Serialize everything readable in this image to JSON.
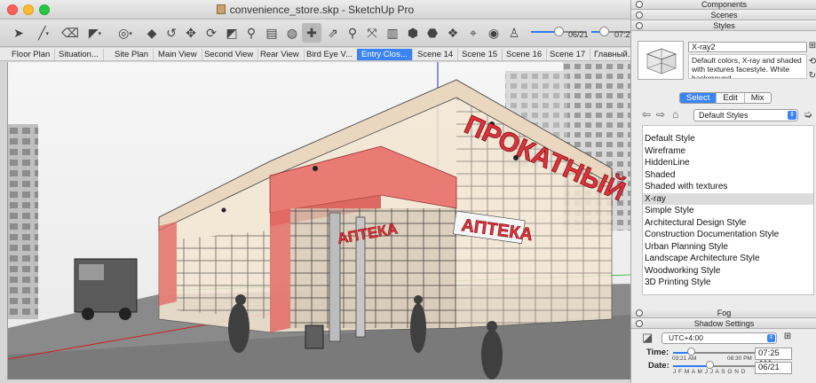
{
  "window": {
    "title": "convenience_store.skp - SketchUp Pro"
  },
  "toolbar": {
    "time_date": "06/21",
    "time_value": "07:2"
  },
  "scene_tabs": [
    {
      "label": "Floor Plan",
      "active": false
    },
    {
      "label": "Situation...",
      "active": false
    },
    {
      "label": "Site Plan",
      "active": false
    },
    {
      "label": "Main View",
      "active": false
    },
    {
      "label": "Second View",
      "active": false
    },
    {
      "label": "Rear View",
      "active": false
    },
    {
      "label": "Bird Eye V...",
      "active": false
    },
    {
      "label": "Entry Clos...",
      "active": true
    },
    {
      "label": "Scene 14",
      "active": false
    },
    {
      "label": "Scene 15",
      "active": false
    },
    {
      "label": "Scene 16",
      "active": false
    },
    {
      "label": "Scene 17",
      "active": false
    },
    {
      "label": "Главный...",
      "active": false
    }
  ],
  "viewport": {
    "sign_main": "ПРОКАТНЫЙ",
    "sign_pharmacy": "АПТЕКА",
    "sign_pharmacy_left": "АПТЕКА"
  },
  "tray": {
    "panels": {
      "components": "Components",
      "scenes": "Scenes",
      "styles": "Styles",
      "fog": "Fog",
      "shadow": "Shadow Settings"
    },
    "styles": {
      "name": "X-ray2",
      "description": "Default colors, X-ray and shaded with textures facestyle. White background",
      "tabs": [
        "Select",
        "Edit",
        "Mix"
      ],
      "active_tab": "Select",
      "collection": "Default Styles",
      "items": [
        "Default Style",
        "Wireframe",
        "HiddenLine",
        "Shaded",
        "Shaded with textures",
        "X-ray",
        "Simple Style",
        "Architectural Design Style",
        "Construction Documentation Style",
        "Urban Planning Style",
        "Landscape Architecture Style",
        "Woodworking Style",
        "3D Printing Style"
      ],
      "selected_item": "X-ray"
    },
    "shadow": {
      "timezone": "UTC+4:00",
      "time_label": "Time:",
      "time_start": "03:21 AM",
      "time_end": "08:30 PM",
      "time_value": "07:25 AM",
      "date_label": "Date:",
      "months": "J F M A M J J A S O N D",
      "date_value": "06/21",
      "time_fraction": 0.23,
      "date_fraction": 0.45
    }
  }
}
